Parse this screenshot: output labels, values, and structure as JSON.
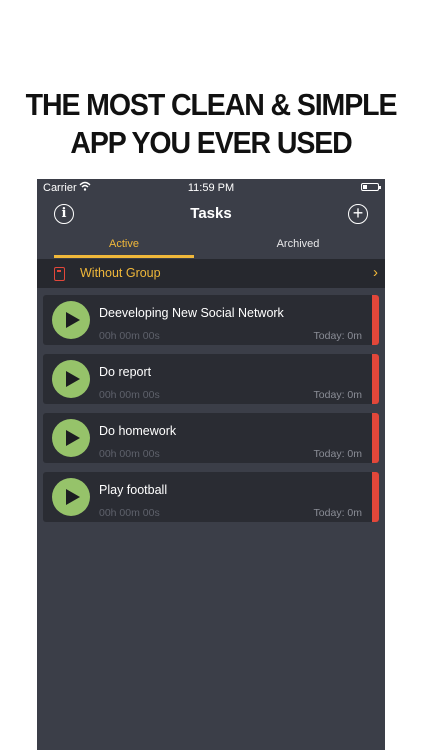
{
  "headline": {
    "line1": "THE MOST CLEAN & SIMPLE",
    "line2": "APP YOU EVER USED"
  },
  "statusbar": {
    "carrier": "Carrier",
    "time": "11:59 PM"
  },
  "navbar": {
    "title": "Tasks",
    "info_icon": "i",
    "add_icon": "+"
  },
  "tabs": {
    "active_label": "Active",
    "archived_label": "Archived"
  },
  "group": {
    "label": "Without Group",
    "chevron": "›"
  },
  "tasks": [
    {
      "name": "Deeveloping New Social Network",
      "timer": "00h 00m 00s",
      "today": "Today: 0m"
    },
    {
      "name": "Do report",
      "timer": "00h 00m 00s",
      "today": "Today: 0m"
    },
    {
      "name": "Do homework",
      "timer": "00h 00m 00s",
      "today": "Today: 0m"
    },
    {
      "name": "Play football",
      "timer": "00h 00m 00s",
      "today": "Today: 0m"
    }
  ],
  "colors": {
    "accent": "#f0b83a",
    "play": "#96c36a",
    "stripe": "#e2473a",
    "background": "#3b3e48"
  }
}
